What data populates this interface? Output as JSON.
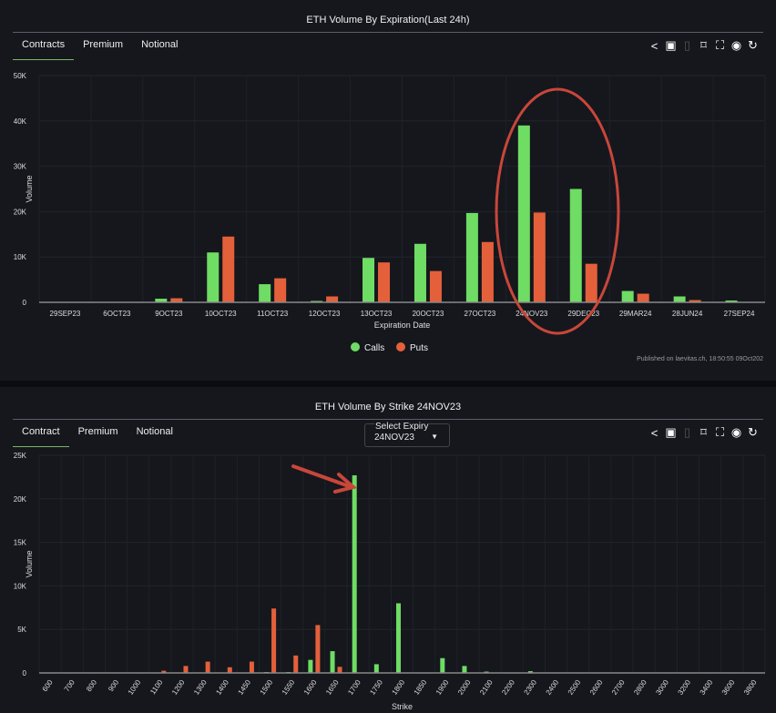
{
  "panel1": {
    "title": "ETH Volume By Expiration(Last 24h)",
    "tabs": [
      "Contracts",
      "Premium",
      "Notional"
    ],
    "published": "Published on laevitas.ch, 18:50:55 09Oct202"
  },
  "panel2": {
    "title": "ETH Volume By Strike 24NOV23",
    "tabs": [
      "Contract",
      "Premium",
      "Notional"
    ],
    "select_label": "Select Expiry",
    "select_value": "24NOV23"
  },
  "icons": [
    "share-icon",
    "image-download-icon",
    "csv-icon",
    "bookmark-icon",
    "fullscreen-icon",
    "eye-icon",
    "refresh-icon"
  ],
  "colors": {
    "calls": "#6fdc64",
    "puts": "#e4603a",
    "annotation": "#c9463a"
  },
  "chart_data": [
    {
      "type": "bar",
      "title": "ETH Volume By Expiration(Last 24h)",
      "xlabel": "Expiration Date",
      "ylabel": "Volume",
      "ylim": [
        0,
        50000
      ],
      "yticks": [
        "0",
        "10K",
        "20K",
        "30K",
        "40K",
        "50K"
      ],
      "legend": "bottom",
      "categories": [
        "29SEP23",
        "6OCT23",
        "9OCT23",
        "10OCT23",
        "11OCT23",
        "12OCT23",
        "13OCT23",
        "20OCT23",
        "27OCT23",
        "24NOV23",
        "29DEC23",
        "29MAR24",
        "28JUN24",
        "27SEP24"
      ],
      "series": [
        {
          "name": "Calls",
          "values": [
            50,
            100,
            800,
            11000,
            4000,
            300,
            9800,
            12900,
            19700,
            39000,
            25000,
            2500,
            1300,
            400
          ]
        },
        {
          "name": "Puts",
          "values": [
            50,
            100,
            900,
            14500,
            5300,
            1300,
            8800,
            6900,
            13300,
            19800,
            8500,
            1900,
            500,
            100
          ]
        }
      ]
    },
    {
      "type": "bar",
      "title": "ETH Volume By Strike 24NOV23",
      "xlabel": "Strike",
      "ylabel": "Volume",
      "ylim": [
        0,
        25000
      ],
      "yticks": [
        "0",
        "5K",
        "10K",
        "15K",
        "20K",
        "25K"
      ],
      "categories": [
        "600",
        "700",
        "800",
        "900",
        "1000",
        "1100",
        "1200",
        "1300",
        "1400",
        "1450",
        "1500",
        "1550",
        "1600",
        "1650",
        "1700",
        "1750",
        "1800",
        "1850",
        "1900",
        "2000",
        "2100",
        "2200",
        "2300",
        "2400",
        "2500",
        "2600",
        "2700",
        "2800",
        "3000",
        "3200",
        "3400",
        "3600",
        "3800"
      ],
      "series": [
        {
          "name": "Calls",
          "values": [
            0,
            0,
            0,
            0,
            0,
            0,
            0,
            0,
            0,
            0,
            100,
            100,
            1500,
            2500,
            22700,
            1000,
            8000,
            0,
            1700,
            800,
            150,
            50,
            200,
            0,
            0,
            0,
            0,
            0,
            0,
            0,
            0,
            0,
            0
          ]
        },
        {
          "name": "Puts",
          "values": [
            0,
            0,
            0,
            50,
            50,
            250,
            800,
            1300,
            650,
            1300,
            7400,
            2000,
            5500,
            700,
            0,
            0,
            0,
            0,
            0,
            0,
            0,
            0,
            0,
            0,
            0,
            0,
            0,
            0,
            0,
            0,
            0,
            0,
            0
          ]
        }
      ]
    }
  ]
}
